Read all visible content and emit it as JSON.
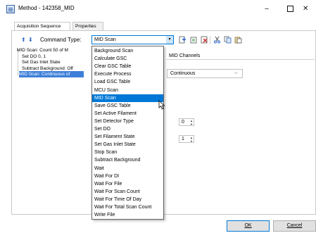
{
  "window": {
    "title": "Method - 142358_MID",
    "minimize_glyph": "–",
    "maximize_glyph": "",
    "close_glyph": "✕"
  },
  "tabs": [
    {
      "label": "Acquisition Sequence",
      "active": true
    },
    {
      "label": "Properties",
      "active": false
    }
  ],
  "toolbar": {
    "move_up_icon": "arrow-up-icon",
    "move_down_icon": "arrow-down-icon",
    "command_type_label": "Command Type:",
    "command_type_value": "MID Scan",
    "dropdown_glyph": "▾"
  },
  "sequence_tree": [
    "MID Scan: Count 50 of M",
    "Set DO 0, 1",
    "Set Gas Inlet State",
    "Subtract Background: Off",
    "MID Scan: Continuous of"
  ],
  "command_options": [
    "Background Scan",
    "Calculate GSC",
    "Clear GSC Table",
    "Execute Process",
    "Load GSC Table",
    "MCU Scan",
    "MID Scan",
    "Save GSC Table",
    "Set Active Filament",
    "Set Detector Type",
    "Set DO",
    "Set Filament State",
    "Set Gas Inlet State",
    "Stop Scan",
    "Subtract Background",
    "Wait",
    "Wait For DI",
    "Wait For File",
    "Wait For Scan Count",
    "Wait For Time Of Day",
    "Wait For Total Scan Count",
    "Write File"
  ],
  "selected_option": "MID Scan",
  "properties": {
    "channels_tab": "MID Channels",
    "mode_value": "Continuous",
    "mode_chevron": "⌵",
    "spin_a_value": "0",
    "spin_b_value": "1"
  },
  "buttons": {
    "ok": "OK",
    "cancel": "Cancel"
  },
  "colors": {
    "selection": "#0078d7",
    "tree_selection": "#3d7fd8",
    "accent_icon": "#2c69c4"
  }
}
